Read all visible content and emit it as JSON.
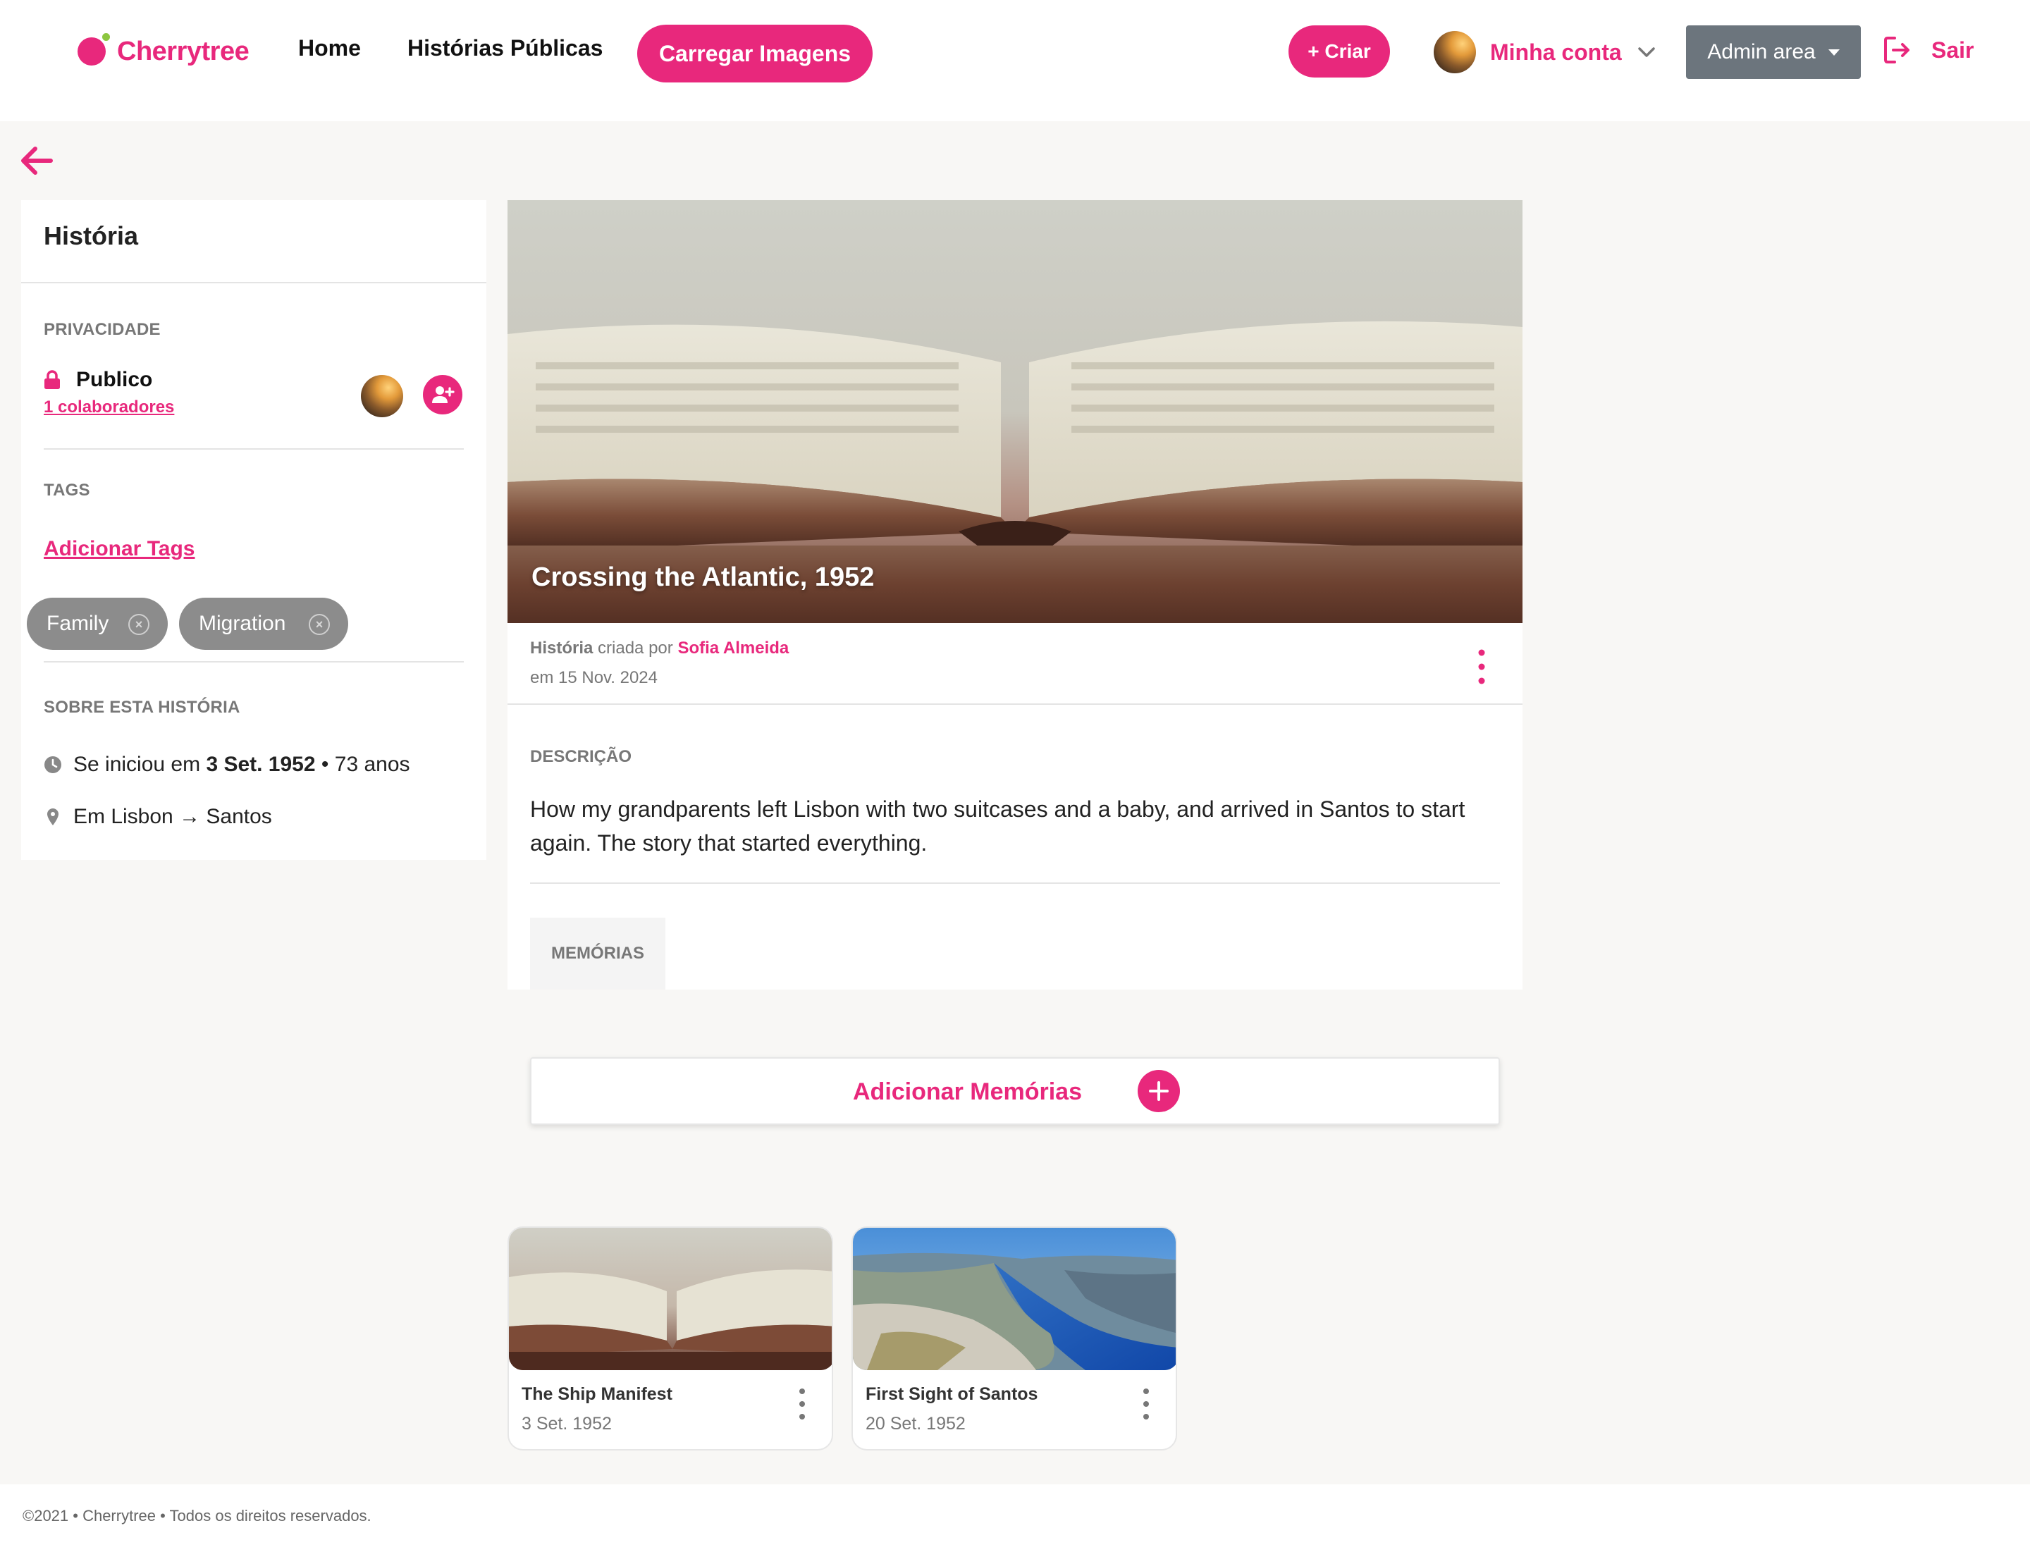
{
  "nav": {
    "brand": "Cherrytree",
    "home": "Home",
    "public_stories": "Histórias Públicas",
    "upload_button": "Carregar Imagens",
    "create_button": "+ Criar",
    "account_label": "Minha conta",
    "admin_label": "Admin area",
    "logout_label": "Sair"
  },
  "sidebar": {
    "title": "História",
    "privacy_heading": "PRIVACIDADE",
    "privacy_value": "Publico",
    "collaborators_link": "1 colaboradores",
    "tags_heading": "TAGS",
    "add_tags_link": "Adicionar Tags",
    "tags": [
      {
        "label": "Family"
      },
      {
        "label": "Migration"
      }
    ],
    "about_heading": "SOBRE ESTA HISTÓRIA",
    "started_prefix": "Se iniciou em",
    "started_date": "3 Set. 1952",
    "started_separator": "•",
    "started_age": "73 anos",
    "location": "Em Lisbon → Santos"
  },
  "story": {
    "title": "Crossing the Atlantic, 1952",
    "meta_kind": "História",
    "meta_created_by": "criada por",
    "author": "Sofia Almeida",
    "created_on": "em 15 Nov. 2024",
    "description_heading": "DESCRIÇÃO",
    "description": "How my grandparents left Lisbon with two suitcases and a baby, and arrived in Santos to start again. The story that started everything.",
    "memories_tab": "MEMÓRIAS"
  },
  "add_memories_label": "Adicionar Memórias",
  "memories": [
    {
      "title": "The Ship Manifest",
      "date": "3 Set. 1952",
      "image": "open-book"
    },
    {
      "title": "First Sight of Santos",
      "date": "20 Set. 1952",
      "image": "fjord-landscape"
    }
  ],
  "footer": {
    "text": "©2021 • Cherrytree • Todos os direitos reservados."
  },
  "colors": {
    "accent": "#e8287c",
    "admin_button": "#6c757d",
    "tag_background": "#8c8c8c",
    "page_background": "#f8f7f5"
  },
  "icons": {
    "back": "arrow-left-icon",
    "lock": "lock-icon",
    "add_user": "add-user-icon",
    "clock": "clock-icon",
    "pin": "map-pin-icon",
    "logout": "logout-icon",
    "kebab": "kebab-menu-icon",
    "plus": "plus-icon",
    "chevron": "chevron-down-icon"
  }
}
